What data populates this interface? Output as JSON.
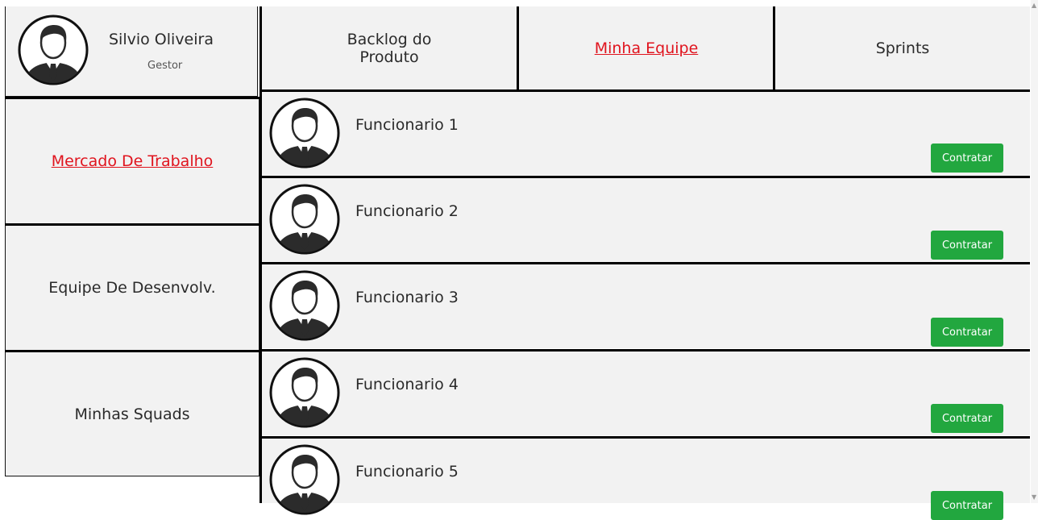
{
  "profile": {
    "name": "Silvio Oliveira",
    "role": "Gestor",
    "avatar_icon": "person-avatar-icon"
  },
  "sidebar": {
    "items": [
      {
        "label": "Mercado De Trabalho",
        "active": true
      },
      {
        "label": "Equipe De Desenvolv.",
        "active": false
      },
      {
        "label": "Minhas Squads",
        "active": false
      }
    ]
  },
  "tabs": [
    {
      "label": "Backlog do Produto",
      "line1": "Backlog do",
      "line2": "Produto",
      "active": false
    },
    {
      "label": "Minha Equipe",
      "active": true
    },
    {
      "label": "Sprints",
      "active": false
    }
  ],
  "employees": [
    {
      "name": "Funcionario 1",
      "action": "Contratar"
    },
    {
      "name": "Funcionario 2",
      "action": "Contratar"
    },
    {
      "name": "Funcionario 3",
      "action": "Contratar"
    },
    {
      "name": "Funcionario 4",
      "action": "Contratar"
    },
    {
      "name": "Funcionario 5",
      "action": "Contratar"
    }
  ],
  "colors": {
    "active_link": "#e0141e",
    "hire_button": "#22a73f",
    "panel_bg": "#f2f2f2",
    "border": "#000000"
  }
}
